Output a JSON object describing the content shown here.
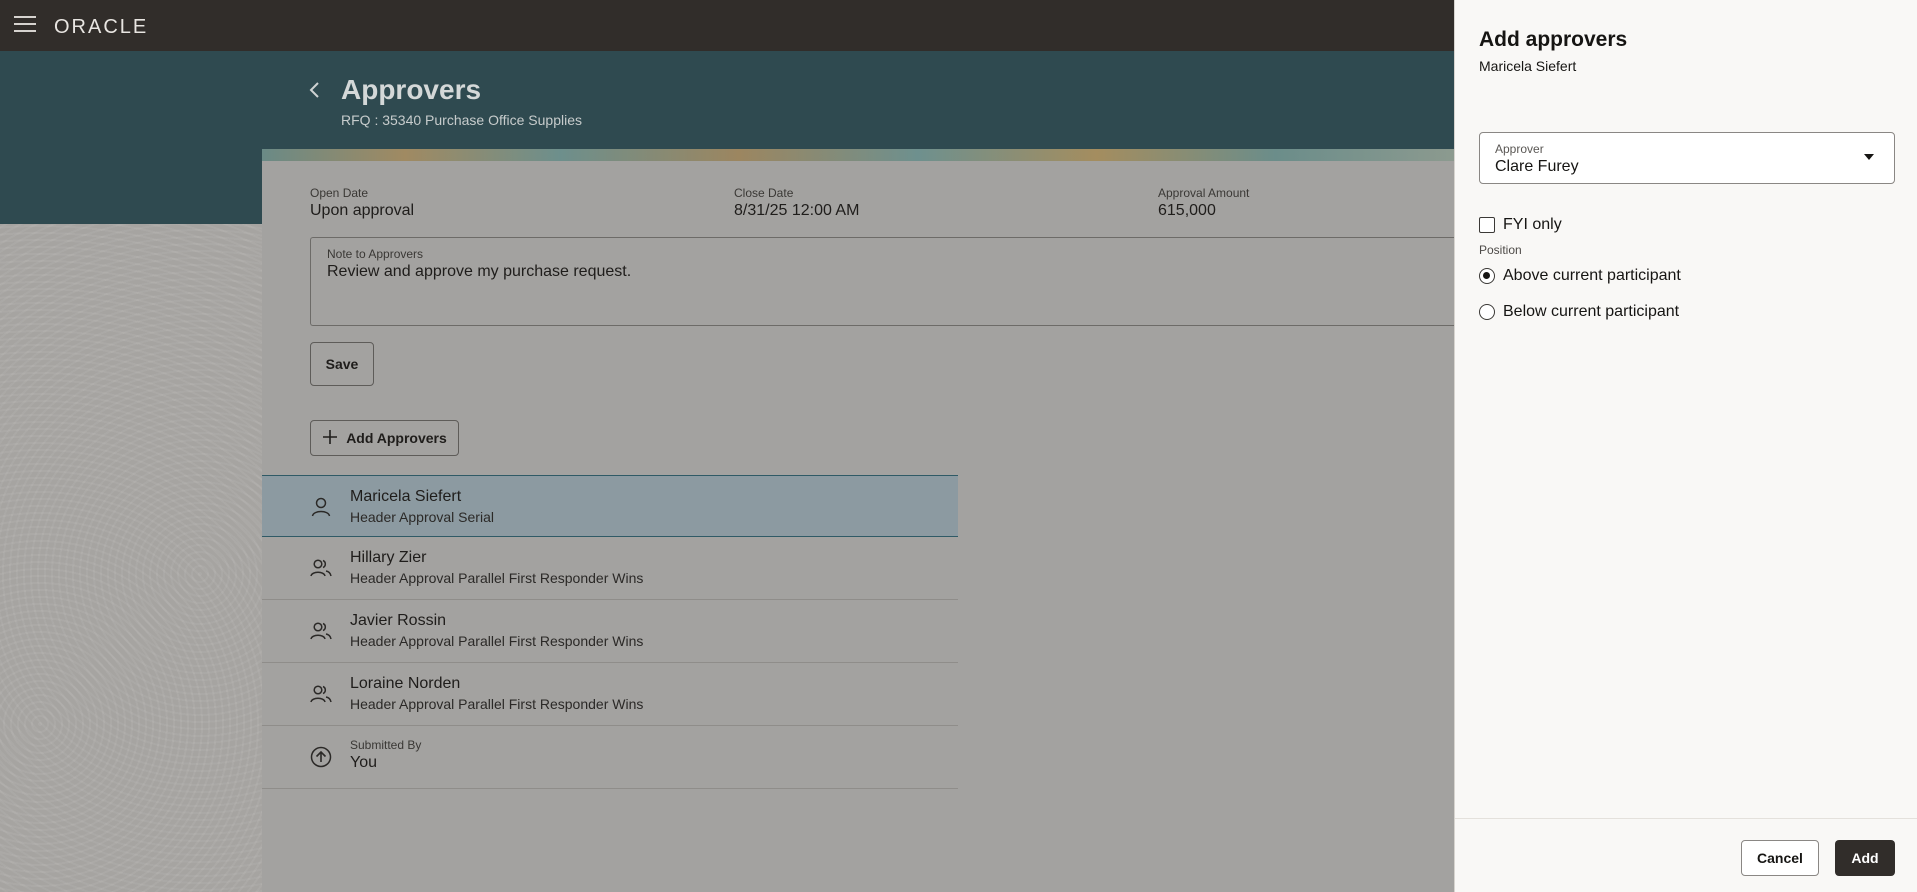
{
  "app": {
    "brand": "ORACLE"
  },
  "header": {
    "title": "Approvers",
    "subtitle": "RFQ : 35340 Purchase Office Supplies"
  },
  "details": {
    "open_date_label": "Open Date",
    "open_date_value": "Upon approval",
    "close_date_label": "Close Date",
    "close_date_value": "8/31/25 12:00 AM",
    "approval_amount_label": "Approval Amount",
    "approval_amount_value": "615,000"
  },
  "note": {
    "label": "Note to Approvers",
    "value": "Review and approve my purchase request."
  },
  "buttons": {
    "save": "Save",
    "add_approvers": "Add Approvers"
  },
  "approvers": [
    {
      "name": "Maricela Siefert",
      "role": "Header Approval Serial",
      "icon": "person-icon",
      "selected": true
    },
    {
      "name": "Hillary Zier",
      "role": "Header Approval Parallel First Responder Wins",
      "icon": "people-icon"
    },
    {
      "name": "Javier Rossin",
      "role": "Header Approval Parallel First Responder Wins",
      "icon": "people-icon"
    },
    {
      "name": "Loraine Norden",
      "role": "Header Approval Parallel First Responder Wins",
      "icon": "people-icon"
    }
  ],
  "submitted": {
    "label": "Submitted By",
    "value": "You"
  },
  "drawer": {
    "title": "Add approvers",
    "subtitle": "Maricela Siefert",
    "approver_label": "Approver",
    "approver_value": "Clare Furey",
    "fyi_label": "FYI only",
    "fyi_checked": false,
    "position_label": "Position",
    "position_options": [
      {
        "label": "Above current participant",
        "checked": true
      },
      {
        "label": "Below current participant",
        "checked": false
      }
    ],
    "cancel_label": "Cancel",
    "add_label": "Add"
  }
}
